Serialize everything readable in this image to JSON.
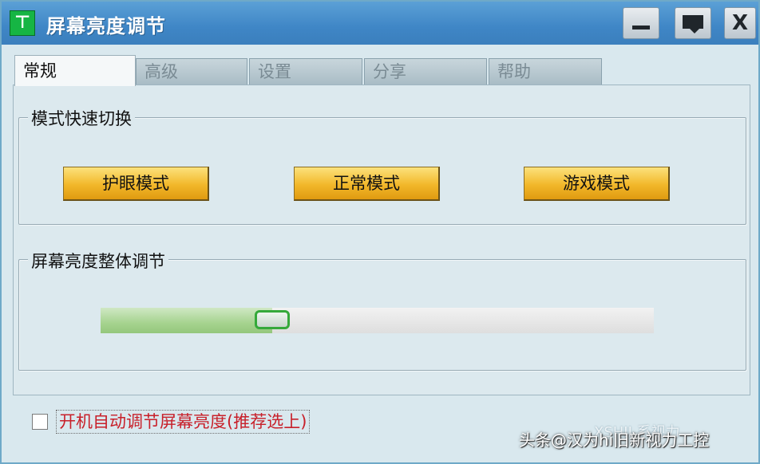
{
  "window": {
    "title": "屏幕亮度调节",
    "app_icon": "monitor-green-icon",
    "controls": [
      "minimize-icon",
      "feedback-icon",
      "close-icon"
    ],
    "close_label": "X"
  },
  "tabs": [
    {
      "label": "常规",
      "active": true
    },
    {
      "label": "高级",
      "active": false
    },
    {
      "label": "设置",
      "active": false
    },
    {
      "label": "分享",
      "active": false
    },
    {
      "label": "帮助",
      "active": false
    }
  ],
  "mode_group": {
    "legend": "模式快速切换",
    "buttons": [
      "护眼模式",
      "正常模式",
      "游戏模式"
    ]
  },
  "brightness_group": {
    "legend": "屏幕亮度整体调节",
    "value_fraction": 0.31
  },
  "autostart": {
    "label": "开机自动调节屏幕亮度(推荐选上)",
    "checked": false
  },
  "watermark": {
    "text": "头条@汉为hi旧新视力工控",
    "logo_text": "XSHII 系视力"
  },
  "colors": {
    "titlebar": "#3f86c6",
    "mode_button": "#f2b72a",
    "slider_fill": "#a6d38f",
    "slider_thumb_border": "#35a93a",
    "autostart_text": "#c8202a"
  }
}
